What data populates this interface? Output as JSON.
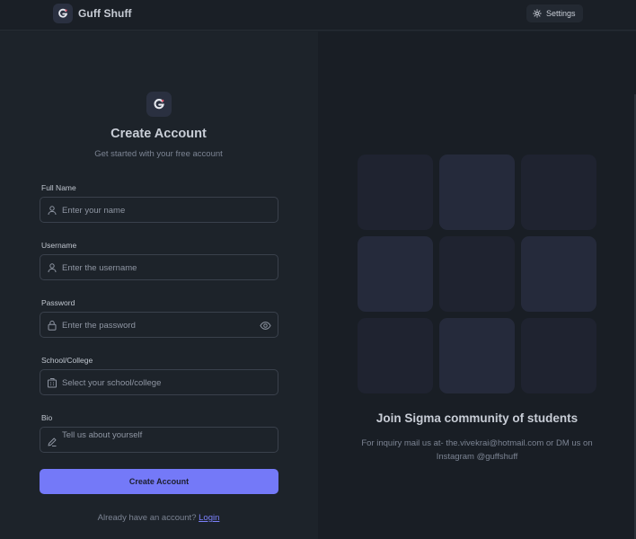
{
  "navbar": {
    "title": "Guff Shuff",
    "settings_label": "Settings",
    "logo_icon": "g-logo-icon",
    "settings_icon": "gear-icon"
  },
  "form": {
    "heading": "Create Account",
    "subheading": "Get started with your free account",
    "fields": {
      "full_name": {
        "label": "Full Name",
        "placeholder": "Enter your name",
        "icon": "user-icon"
      },
      "username": {
        "label": "Username",
        "placeholder": "Enter the username",
        "icon": "user-icon"
      },
      "password": {
        "label": "Password",
        "placeholder": "Enter the password",
        "icon": "lock-icon"
      },
      "school": {
        "label": "School/College",
        "placeholder": "Select your school/college",
        "icon": "building-icon"
      },
      "bio": {
        "label": "Bio",
        "placeholder": "Tell us about yourself",
        "icon": "pencil-icon"
      }
    },
    "submit_label": "Create Account",
    "footer_prompt": "Already have an account?",
    "footer_link": "Login"
  },
  "promo": {
    "title": "Join Sigma community of students",
    "description": "For inquiry mail us at- the.vivekrai@hotmail.com or DM us on Instagram @guffshuff"
  },
  "colors": {
    "accent": "#7479f8",
    "background": "#1d232a",
    "panel_dark": "#191e25",
    "tile_light": "#252a3b",
    "tile_dark": "#1f2330"
  }
}
